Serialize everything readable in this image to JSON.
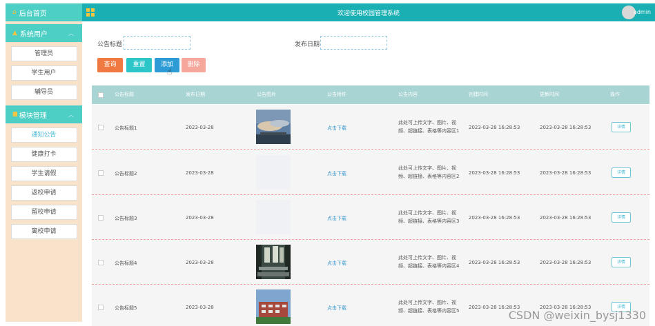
{
  "sidebar": {
    "home_label": "后台首页",
    "sections": [
      {
        "label": "系统用户",
        "items": [
          "管理员",
          "学生用户",
          "辅导员"
        ]
      },
      {
        "label": "模块管理",
        "items": [
          "通知公告",
          "健康打卡",
          "学生请假",
          "返校申请",
          "留校申请",
          "离校申请"
        ]
      }
    ],
    "active_item": "通知公告"
  },
  "header": {
    "title": "欢迎使用校园管理系统",
    "user": "admin"
  },
  "search": {
    "title_label": "公告标题",
    "date_label": "发布日期",
    "title_value": "",
    "date_value": ""
  },
  "buttons": {
    "search": "查询",
    "reset": "重置",
    "add": "添加",
    "delete": "删除"
  },
  "table": {
    "columns": [
      "公告标题",
      "发布日期",
      "公告图片",
      "公告附件",
      "公告内容",
      "创建时间",
      "更新时间",
      "操作"
    ],
    "rows": [
      {
        "title": "公告标题1",
        "date": "2023-03-28",
        "image": "sunset-sky",
        "attachment": "点击下载",
        "content": "此处可上传文字、图片、视频、超链接、表格等内容区1",
        "created": "2023-03-28 16:28:53",
        "updated": "2023-03-28 16:28:53",
        "action": "详情"
      },
      {
        "title": "公告标题2",
        "date": "2023-03-28",
        "image": "blank",
        "attachment": "点击下载",
        "content": "此处可上传文字、图片、视频、超链接、表格等内容区2",
        "created": "2023-03-28 16:28:53",
        "updated": "2023-03-28 16:28:53",
        "action": "详情"
      },
      {
        "title": "公告标题3",
        "date": "2023-03-28",
        "image": "blank",
        "attachment": "点击下载",
        "content": "此处可上传文字、图片、视频、超链接、表格等内容区3",
        "created": "2023-03-28 16:28:53",
        "updated": "2023-03-28 16:28:53",
        "action": "详情"
      },
      {
        "title": "公告标题4",
        "date": "2023-03-28",
        "image": "canteen",
        "attachment": "点击下载",
        "content": "此处可上传文字、图片、视频、超链接、表格等内容区4",
        "created": "2023-03-28 16:28:53",
        "updated": "2023-03-28 16:28:53",
        "action": "详情"
      },
      {
        "title": "公告标题5",
        "date": "2023-03-28",
        "image": "building",
        "attachment": "点击下载",
        "content": "此处可上传文字、图片、视频、超链接、表格等内容区5",
        "created": "2023-03-28 16:28:53",
        "updated": "2023-03-28 16:28:53",
        "action": "详情"
      }
    ]
  },
  "watermark": "CSDN @weixin_bysj1330",
  "colors": {
    "sidebar_bg": "#f8e2c9",
    "sidebar_header": "#4ecfc5",
    "topbar": "#1ab0b3",
    "table_header": "#a8d4d4",
    "search_btn": "#f07941",
    "reset_btn": "#2cc6c9",
    "add_btn": "#2c9bd6",
    "delete_btn": "#f5a79b"
  }
}
